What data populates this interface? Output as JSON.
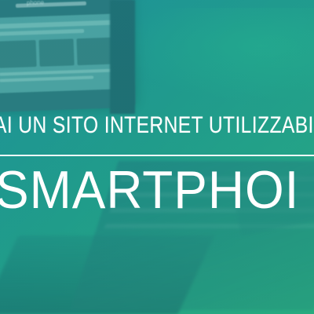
{
  "screen": {
    "small_word": "phone"
  },
  "headline": {
    "line1": "AI UN SITO INTERNET UTILIZZABI",
    "line2": "SMARTPHOI"
  },
  "colors": {
    "overlay": "#1f9a86",
    "text": "#ffffff"
  }
}
